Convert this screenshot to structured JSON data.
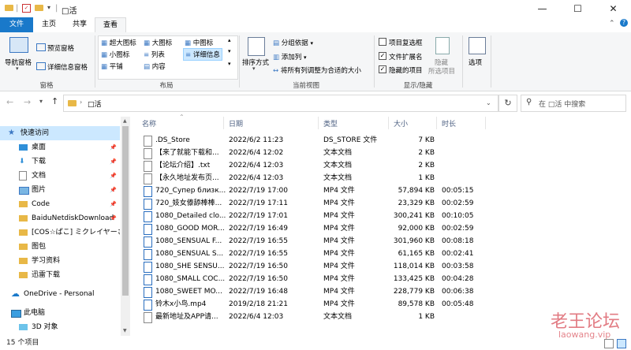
{
  "window": {
    "title": "□活",
    "controls": [
      "—",
      "☐",
      "✕"
    ]
  },
  "tabs": [
    "文件",
    "主页",
    "共享",
    "查看"
  ],
  "ribbon": {
    "pane": {
      "nav_pane": "导航窗格",
      "preview": "预览窗格",
      "details": "详细信息窗格",
      "group": "窗格"
    },
    "layout": {
      "items": [
        "超大图标",
        "大图标",
        "中图标",
        "小图标",
        "列表",
        "详细信息",
        "平铺",
        "内容"
      ],
      "group": "布局"
    },
    "current_view": {
      "sort": "排序方式",
      "group_by": "分组依据",
      "add_column": "添加列",
      "fit_columns": "将所有列调整为合适的大小",
      "group": "当前视图"
    },
    "show_hide": {
      "item_checkboxes": "项目复选框",
      "file_ext": "文件扩展名",
      "hidden_items": "隐藏的项目",
      "hide": "隐藏",
      "hide_selected": "所选项目",
      "group": "显示/隐藏"
    },
    "options": "选项"
  },
  "address": {
    "path": "□活",
    "search_placeholder": "在 □活 中搜索"
  },
  "nav": [
    {
      "label": "快速访问",
      "icon": "star-icon",
      "pinned": false
    },
    {
      "label": "桌面",
      "icon": "desktop-icon",
      "pinned": true
    },
    {
      "label": "下载",
      "icon": "download-icon",
      "pinned": true
    },
    {
      "label": "文档",
      "icon": "document-icon",
      "pinned": true
    },
    {
      "label": "图片",
      "icon": "picture-icon",
      "pinned": true
    },
    {
      "label": "Code",
      "icon": "folder-icon",
      "pinned": true
    },
    {
      "label": "BaiduNetdiskDownload",
      "icon": "folder-icon",
      "pinned": true
    },
    {
      "label": "[COS☆ぱこ] ミクレイヤーさ",
      "icon": "folder-icon",
      "pinned": false
    },
    {
      "label": "图包",
      "icon": "folder-icon",
      "pinned": false
    },
    {
      "label": "学习资料",
      "icon": "folder-icon",
      "pinned": false
    },
    {
      "label": "迅雷下载",
      "icon": "folder-icon",
      "pinned": false
    },
    {
      "label": "OneDrive - Personal",
      "icon": "cloud-icon",
      "pinned": false
    },
    {
      "label": "此电脑",
      "icon": "computer-icon",
      "pinned": false
    },
    {
      "label": "3D 对象",
      "icon": "cube-icon",
      "pinned": false
    }
  ],
  "columns": [
    "名称",
    "日期",
    "类型",
    "大小",
    "时长"
  ],
  "files": [
    {
      "name": ".DS_Store",
      "date": "2022/6/2 11:23",
      "type": "DS_STORE 文件",
      "size": "7 KB",
      "duration": "",
      "kind": "doc"
    },
    {
      "name": "【来了就能下载和...",
      "date": "2022/6/4 12:02",
      "type": "文本文档",
      "size": "2 KB",
      "duration": "",
      "kind": "doc"
    },
    {
      "name": "【论坛介绍】.txt",
      "date": "2022/6/4 12:03",
      "type": "文本文档",
      "size": "2 KB",
      "duration": "",
      "kind": "doc"
    },
    {
      "name": "【永久地址发布页...",
      "date": "2022/6/4 12:03",
      "type": "文本文档",
      "size": "1 KB",
      "duration": "",
      "kind": "doc"
    },
    {
      "name": "720_Супер близк...",
      "date": "2022/7/19 17:00",
      "type": "MP4 文件",
      "size": "57,894 KB",
      "duration": "00:05:15",
      "kind": "mp4"
    },
    {
      "name": "720_妓女傣舔棒棒...",
      "date": "2022/7/19 17:11",
      "type": "MP4 文件",
      "size": "23,329 KB",
      "duration": "00:02:59",
      "kind": "mp4"
    },
    {
      "name": "1080_Detailed clo...",
      "date": "2022/7/19 17:01",
      "type": "MP4 文件",
      "size": "300,241 KB",
      "duration": "00:10:05",
      "kind": "mp4"
    },
    {
      "name": "1080_GOOD MOR...",
      "date": "2022/7/19 16:49",
      "type": "MP4 文件",
      "size": "92,000 KB",
      "duration": "00:02:59",
      "kind": "mp4"
    },
    {
      "name": "1080_SENSUAL F...",
      "date": "2022/7/19 16:55",
      "type": "MP4 文件",
      "size": "301,960 KB",
      "duration": "00:08:18",
      "kind": "mp4"
    },
    {
      "name": "1080_SENSUAL S...",
      "date": "2022/7/19 16:55",
      "type": "MP4 文件",
      "size": "61,165 KB",
      "duration": "00:02:41",
      "kind": "mp4"
    },
    {
      "name": "1080_SHE SENSU...",
      "date": "2022/7/19 16:50",
      "type": "MP4 文件",
      "size": "118,014 KB",
      "duration": "00:03:58",
      "kind": "mp4"
    },
    {
      "name": "1080_SMALL COC...",
      "date": "2022/7/19 16:50",
      "type": "MP4 文件",
      "size": "133,425 KB",
      "duration": "00:04:28",
      "kind": "mp4"
    },
    {
      "name": "1080_SWEET MO...",
      "date": "2022/7/19 16:48",
      "type": "MP4 文件",
      "size": "228,779 KB",
      "duration": "00:06:38",
      "kind": "mp4"
    },
    {
      "name": "铃木x小鸟.mp4",
      "date": "2019/2/18 21:21",
      "type": "MP4 文件",
      "size": "89,578 KB",
      "duration": "00:05:48",
      "kind": "mp4"
    },
    {
      "name": "最新地址及APP请...",
      "date": "2022/6/4 12:03",
      "type": "文本文档",
      "size": "1 KB",
      "duration": "",
      "kind": "doc"
    }
  ],
  "status": {
    "count": "15 个项目"
  },
  "watermark": {
    "cn": "老王论坛",
    "url": "laowang.vip"
  },
  "colors": {
    "accent": "#1979ca",
    "selection": "#cce8ff",
    "folder": "#e8b847",
    "watermark": "#d9505a"
  }
}
